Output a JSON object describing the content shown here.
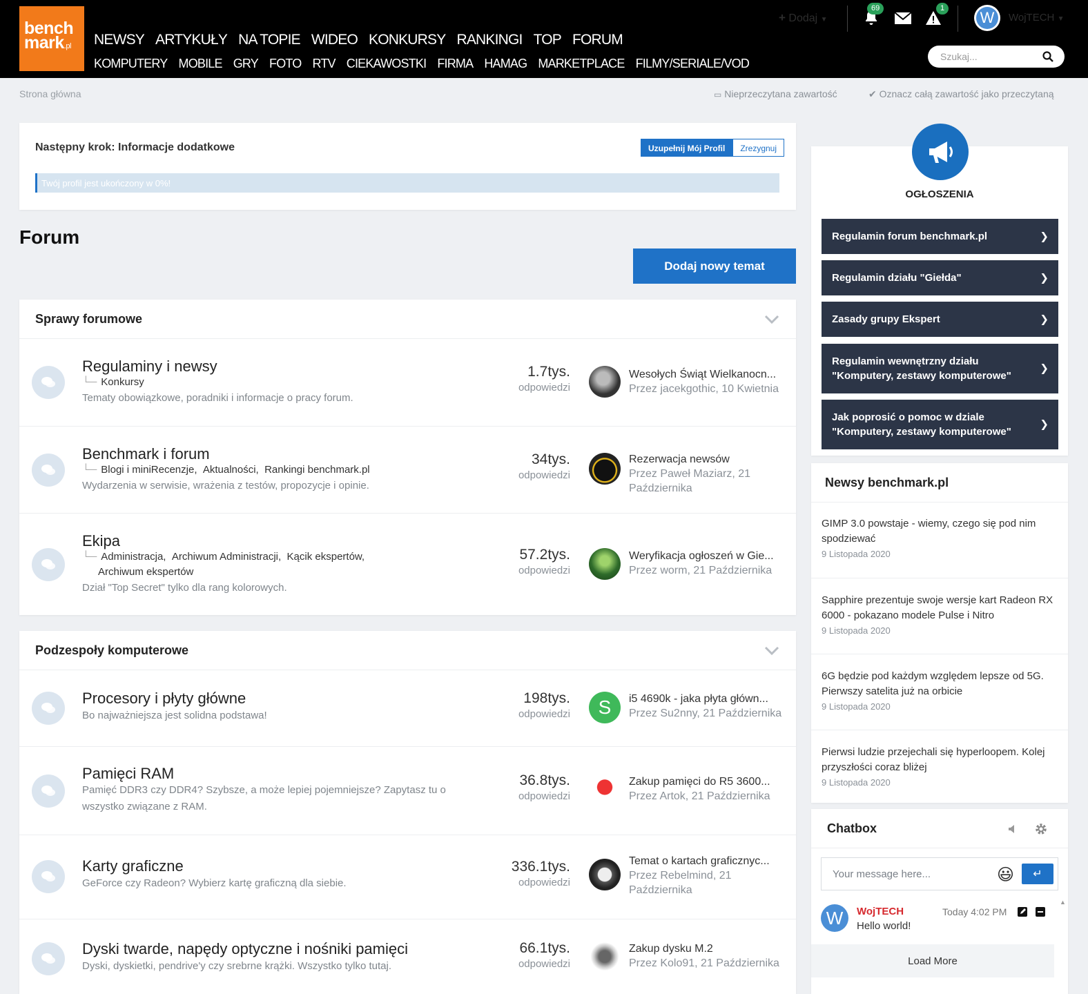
{
  "logo": {
    "line1": "bench",
    "line2": "mark",
    "suffix": ".pl"
  },
  "nav": {
    "row1": [
      "NEWSY",
      "ARTYKUŁY",
      "NA TOPIE",
      "WIDEO",
      "KONKURSY",
      "RANKINGI",
      "TOP",
      "FORUM"
    ],
    "row2": [
      "KOMPUTERY",
      "MOBILE",
      "GRY",
      "FOTO",
      "RTV",
      "CIEKAWOSTKI",
      "FIRMA",
      "HAMAG",
      "MARKETPLACE",
      "FILMY/SERIALE/VOD"
    ]
  },
  "user_bar": {
    "add_label": "Dodaj",
    "notifications_count": "69",
    "alerts_count": "1",
    "avatar_letter": "W",
    "username": "WojTECH"
  },
  "search": {
    "placeholder": "Szukaj..."
  },
  "breadcrumb": {
    "home": "Strona główna",
    "unread": "Nieprzeczytana zawartość",
    "mark_read": "Oznacz całą zawartość jako przeczytaną"
  },
  "next_step": {
    "title": "Następny krok: Informacje dodatkowe",
    "complete_btn": "Uzupełnij Mój Profil",
    "dismiss_btn": "Zrezygnuj",
    "progress_text": "Twój profil jest ukończony w 0%!",
    "progress_value": 0
  },
  "page": {
    "title": "Forum",
    "new_topic_btn": "Dodaj nowy temat"
  },
  "categories": [
    {
      "title": "Sprawy forumowe",
      "forums": [
        {
          "name": "Regulaminy i newsy",
          "subs": [
            "Konkursy"
          ],
          "desc": "Tematy obowiązkowe, poradniki i informacje o pracy forum.",
          "count": "1.7tys.",
          "count_label": "odpowiedzi",
          "last_title": "Wesołych Świąt Wielkanocn...",
          "last_by": "Przez jacekgothic, 10 Kwietnia"
        },
        {
          "name": "Benchmark i forum",
          "subs": [
            "Blogi i miniRecenzje,",
            "Aktualności,",
            "Rankingi benchmark.pl"
          ],
          "desc": "Wydarzenia w serwisie, wrażenia z testów, propozycje i opinie.",
          "count": "34tys.",
          "count_label": "odpowiedzi",
          "last_title": "Rezerwacja newsów",
          "last_by": "Przez Paweł Maziarz, 21 Października"
        },
        {
          "name": "Ekipa",
          "subs": [
            "Administracja,",
            "Archiwum Administracji,",
            "Kącik ekspertów,"
          ],
          "subs2": "Archiwum ekspertów",
          "desc": "Dział \"Top Secret\" tylko dla rang kolorowych.",
          "count": "57.2tys.",
          "count_label": "odpowiedzi",
          "last_title": "Weryfikacja ogłoszeń w Gie...",
          "last_by": "Przez worm, 21 Października"
        }
      ]
    },
    {
      "title": "Podzespoły komputerowe",
      "forums": [
        {
          "name": "Procesory i płyty główne",
          "desc": "Bo najważniejsza jest solidna podstawa!",
          "count": "198tys.",
          "count_label": "odpowiedzi",
          "last_title": "i5 4690k - jaka płyta główn...",
          "last_by": "Przez Su2nny, 21 Października",
          "avatar_letter": "S"
        },
        {
          "name": "Pamięci RAM",
          "desc": "Pamięć DDR3 czy DDR4? Szybsze, a może lepiej pojemniejsze? Zapytasz tu o wszystko związane z RAM.",
          "count": "36.8tys.",
          "count_label": "odpowiedzi",
          "last_title": "Zakup pamięci do R5 3600...",
          "last_by": "Przez Artok, 21 Października"
        },
        {
          "name": "Karty graficzne",
          "desc": "GeForce czy Radeon? Wybierz kartę graficzną dla siebie.",
          "count": "336.1tys.",
          "count_label": "odpowiedzi",
          "last_title": "Temat o kartach graficznyc...",
          "last_by": "Przez Rebelmind, 21 Października"
        },
        {
          "name": "Dyski twarde, napędy optyczne i nośniki pamięci",
          "desc": "Dyski, dyskietki, pendrive'y czy srebrne krążki. Wszystko tylko tutaj.",
          "count": "66.1tys.",
          "count_label": "odpowiedzi",
          "last_title": "Zakup dysku M.2",
          "last_by": "Przez Kolo91, 21 Października"
        }
      ]
    }
  ],
  "sidebar": {
    "announcements_title": "OGŁOSZENIA",
    "links": [
      "Regulamin forum benchmark.pl",
      "Regulamin działu \"Giełda\"",
      "Zasady grupy Ekspert",
      "Regulamin wewnętrzny działu \"Komputery, zestawy komputerowe\"",
      "Jak poprosić o pomoc w dziale \"Komputery, zestawy komputerowe\""
    ],
    "news_title": "Newsy benchmark.pl",
    "news": [
      {
        "title": "GIMP 3.0 powstaje - wiemy, czego się pod nim spodziewać",
        "date": "9 Listopada 2020"
      },
      {
        "title": "Sapphire prezentuje swoje wersje kart Radeon RX 6000 - pokazano modele Pulse i Nitro",
        "date": "9 Listopada 2020"
      },
      {
        "title": "6G będzie pod każdym względem lepsze od 5G. Pierwszy satelita już na orbicie",
        "date": "9 Listopada 2020"
      },
      {
        "title": "Pierwsi ludzie przejechali się hyperloopem. Kolej przyszłości coraz bliżej",
        "date": "9 Listopada 2020"
      }
    ],
    "chatbox": {
      "title": "Chatbox",
      "placeholder": "Your message here...",
      "msg_avatar": "W",
      "msg_user": "WojTECH",
      "msg_time": "Today 4:02 PM",
      "msg_text": "Hello world!",
      "load_more": "Load More"
    }
  },
  "colors": {
    "brand_orange": "#f27a1a",
    "primary_blue": "#1f72c7",
    "sidebar_dark": "#2c3547",
    "badge_green": "#2aa05a",
    "username_red": "#d6292e"
  }
}
